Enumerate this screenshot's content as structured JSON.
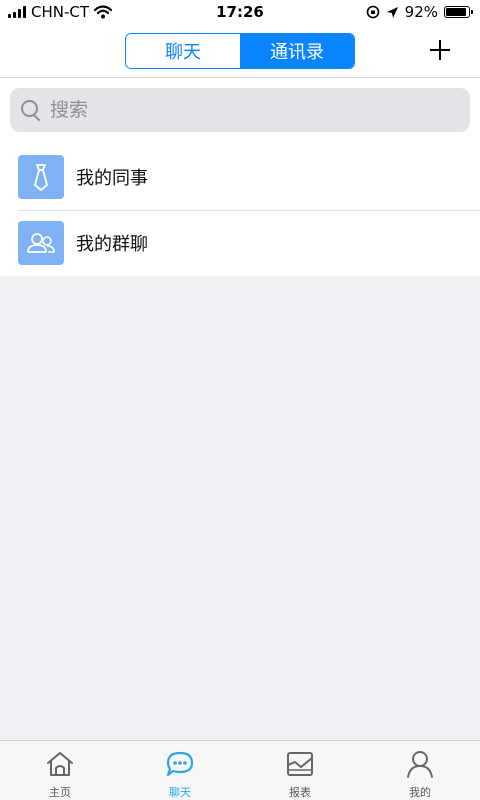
{
  "status_bar": {
    "carrier": "CHN-CT",
    "time": "17:26",
    "battery_text": "92%",
    "battery_level": 0.92
  },
  "nav": {
    "segments": [
      {
        "label": "聊天",
        "active": false
      },
      {
        "label": "通讯录",
        "active": true
      }
    ],
    "add_icon": "plus-icon"
  },
  "search": {
    "placeholder": "搜索",
    "value": ""
  },
  "contacts": [
    {
      "label": "我的同事",
      "icon": "tie-icon"
    },
    {
      "label": "我的群聊",
      "icon": "group-icon"
    }
  ],
  "tabs": [
    {
      "label": "主页",
      "icon": "home-icon",
      "active": false
    },
    {
      "label": "聊天",
      "icon": "chat-icon",
      "active": true
    },
    {
      "label": "报表",
      "icon": "report-icon",
      "active": false
    },
    {
      "label": "我的",
      "icon": "profile-icon",
      "active": false
    }
  ],
  "colors": {
    "accent": "#0a84ff",
    "tab_active": "#29a8e8",
    "avatar_bg": "#7fb2f5",
    "background": "#efeff4"
  }
}
